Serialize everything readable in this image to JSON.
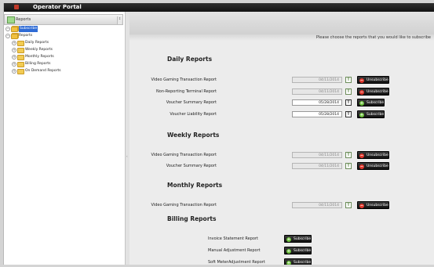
{
  "app": {
    "title": "Operator Portal"
  },
  "sidebar": {
    "header": "Reports",
    "scroll_glyph": "↕",
    "tree": [
      {
        "label": "Subscribe",
        "selected": true
      },
      {
        "label": "Reports"
      },
      {
        "label": "Daily Reports"
      },
      {
        "label": "Weekly Reports"
      },
      {
        "label": "Monthly Reports"
      },
      {
        "label": "Billing Reports"
      },
      {
        "label": "On Demand Reports"
      }
    ]
  },
  "main": {
    "intro": "Please choose the reports that you would like to subscribe",
    "daily": {
      "title": "Daily Reports",
      "rows": [
        {
          "name": "Video Gaming Transaction Report",
          "date": "04/11/2014",
          "action": "Unsubscribe"
        },
        {
          "name": "Non-Reporting Terminal Report",
          "date": "04/11/2014",
          "action": "Unsubscribe"
        },
        {
          "name": "Voucher Summary Report",
          "date": "05/28/2014",
          "action": "Subscribe"
        },
        {
          "name": "Voucher Liability Report",
          "date": "05/28/2014",
          "action": "Subscribe"
        }
      ]
    },
    "weekly": {
      "title": "Weekly Reports",
      "rows": [
        {
          "name": "Video Gaming Transaction Report",
          "date": "04/11/2014",
          "action": "Unsubscribe"
        },
        {
          "name": "Voucher Summary Report",
          "date": "04/11/2014",
          "action": "Unsubscribe"
        }
      ]
    },
    "monthly": {
      "title": "Monthly Reports",
      "rows": [
        {
          "name": "Video Gaming Transaction Report",
          "date": "04/11/2014",
          "action": "Unsubscribe"
        }
      ]
    },
    "billing": {
      "title": "Billing Reports",
      "rows": [
        {
          "name": "Invoice Statement Report",
          "action": "Subscribe"
        },
        {
          "name": "Manual Adjustment Report",
          "action": "Subscribe"
        },
        {
          "name": "Soft MeterAdjustment Report",
          "action": "Subscribe"
        }
      ]
    },
    "icons": {
      "calendar": "T",
      "unsubscribe": "−",
      "subscribe": "+"
    }
  },
  "colors": {
    "title_bar": "#1c1c1c",
    "selection": "#2f6bd5",
    "subscribe_icon": "#6fc23f",
    "unsubscribe_icon": "#e03a30"
  }
}
